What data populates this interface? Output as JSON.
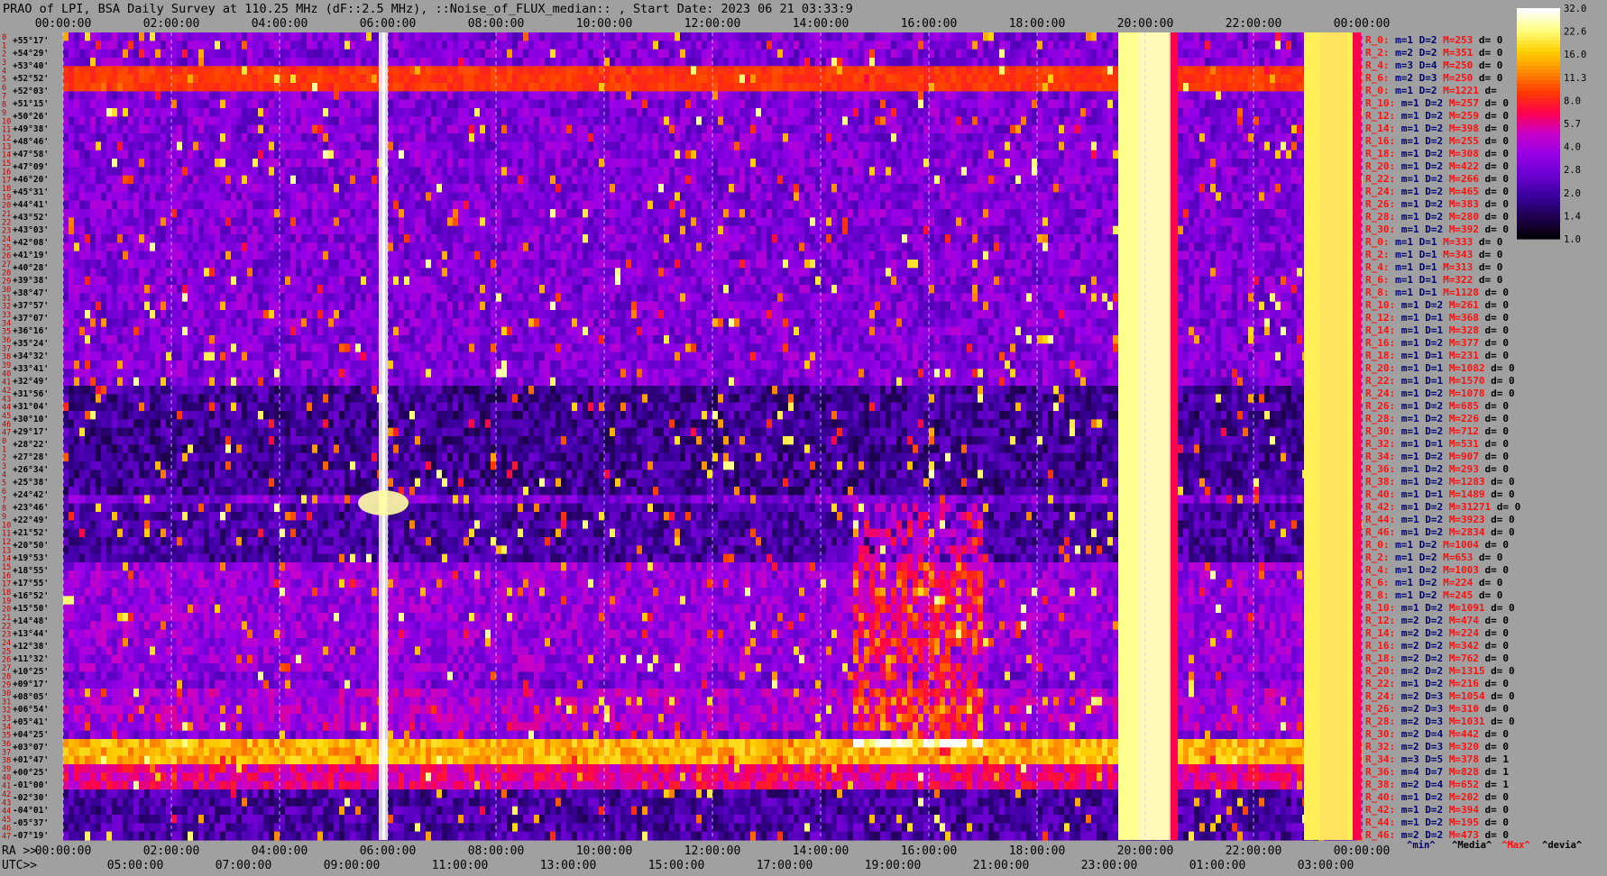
{
  "chart_data": {
    "type": "heatmap",
    "title": "PRAO of LPI, BSA Daily Survey at 110.25 MHz (dF::2.5 MHz), ::Noise_of_FLUX_median:: , Start Date: 2023 06 21 03:33:9",
    "top_time_ticks": [
      "00:00:00",
      "02:00:00",
      "04:00:00",
      "06:00:00",
      "08:00:00",
      "10:00:00",
      "12:00:00",
      "14:00:00",
      "16:00:00",
      "18:00:00",
      "20:00:00",
      "22:00:00",
      "00:00:00"
    ],
    "ra_prefix": "RA >>",
    "ra_ticks": [
      "00:00:00",
      "02:00:00",
      "04:00:00",
      "06:00:00",
      "08:00:00",
      "10:00:00",
      "12:00:00",
      "14:00:00",
      "16:00:00",
      "18:00:00",
      "20:00:00",
      "22:00:00",
      "00:00:00"
    ],
    "utc_prefix": "UTC>>",
    "utc_ticks": [
      "05:00:00",
      "07:00:00",
      "09:00:00",
      "11:00:00",
      "13:00:00",
      "15:00:00",
      "17:00:00",
      "19:00:00",
      "21:00:00",
      "23:00:00",
      "01:00:00",
      "03:00:00"
    ],
    "row_numbers": [
      "0",
      "1",
      "2",
      "3",
      "4",
      "5",
      "6",
      "7",
      "8",
      "9",
      "10",
      "11",
      "12",
      "13",
      "14",
      "15",
      "16",
      "17",
      "18",
      "19",
      "20",
      "21",
      "22",
      "23",
      "24",
      "25",
      "26",
      "27",
      "28",
      "29",
      "30",
      "31",
      "32",
      "33",
      "34",
      "35",
      "36",
      "37",
      "38",
      "39",
      "40",
      "41",
      "42",
      "43",
      "44",
      "45",
      "46",
      "47",
      "0",
      "1",
      "2",
      "3",
      "4",
      "5",
      "6",
      "7",
      "8",
      "9",
      "10",
      "11",
      "12",
      "13",
      "14",
      "15",
      "16",
      "17",
      "18",
      "19",
      "20",
      "21",
      "22",
      "23",
      "24",
      "25",
      "26",
      "27",
      "28",
      "29",
      "30",
      "31",
      "32",
      "33",
      "34",
      "35",
      "36",
      "37",
      "38",
      "39",
      "40",
      "41",
      "42",
      "43",
      "44",
      "45",
      "46",
      "47"
    ],
    "declinations": [
      "+55°17'",
      "+54°29'",
      "+53°40'",
      "+52°52'",
      "+52°03'",
      "+51°15'",
      "+50°26'",
      "+49°38'",
      "+48°46'",
      "+47°58'",
      "+47°09'",
      "+46°20'",
      "+45°31'",
      "+44°41'",
      "+43°52'",
      "+43°03'",
      "+42°08'",
      "+41°19'",
      "+40°28'",
      "+39°38'",
      "+38°47'",
      "+37°57'",
      "+37°07'",
      "+36°16'",
      "+35°24'",
      "+34°32'",
      "+33°41'",
      "+32°49'",
      "+31°56'",
      "+31°04'",
      "+30°10'",
      "+29°17'",
      "+28°22'",
      "+27°28'",
      "+26°34'",
      "+25°38'",
      "+24°42'",
      "+23°46'",
      "+22°49'",
      "+21°52'",
      "+20°50'",
      "+19°53'",
      "+18°55'",
      "+17°55'",
      "+16°52'",
      "+15°50'",
      "+14°48'",
      "+13°44'",
      "+12°38'",
      "+11°32'",
      "+10°25'",
      "+09°17'",
      "+08°05'",
      "+06°54'",
      "+05°41'",
      "+04°25'",
      "+03°07'",
      "+01°47'",
      "+00°25'",
      "-01°00'",
      "-02°30'",
      "-04°01'",
      "-05°37'",
      "-07°19'"
    ],
    "stats": [
      {
        "r": "R_0:",
        "m": "m=1",
        "d": "D=2",
        "M": "M=253",
        "dev": "d= 0"
      },
      {
        "r": "R_2:",
        "m": "m=2",
        "d": "D=2",
        "M": "M=351",
        "dev": "d= 0"
      },
      {
        "r": "R_4:",
        "m": "m=3",
        "d": "D=4",
        "M": "M=250",
        "dev": "d= 0"
      },
      {
        "r": "R_6:",
        "m": "m=2",
        "d": "D=3",
        "M": "M=250",
        "dev": "d= 0"
      },
      {
        "r": "R_0:",
        "m": "m=1",
        "d": "D=2",
        "M": "M=1221",
        "dev": "d="
      },
      {
        "r": "R_10:",
        "m": "m=1",
        "d": "D=2",
        "M": "M=257",
        "dev": "d= 0"
      },
      {
        "r": "R_12:",
        "m": "m=1",
        "d": "D=2",
        "M": "M=259",
        "dev": "d= 0"
      },
      {
        "r": "R_14:",
        "m": "m=1",
        "d": "D=2",
        "M": "M=398",
        "dev": "d= 0"
      },
      {
        "r": "R_16:",
        "m": "m=1",
        "d": "D=2",
        "M": "M=255",
        "dev": "d= 0"
      },
      {
        "r": "R_18:",
        "m": "m=1",
        "d": "D=2",
        "M": "M=308",
        "dev": "d= 0"
      },
      {
        "r": "R_20:",
        "m": "m=1",
        "d": "D=2",
        "M": "M=422",
        "dev": "d= 0"
      },
      {
        "r": "R_22:",
        "m": "m=1",
        "d": "D=2",
        "M": "M=266",
        "dev": "d= 0"
      },
      {
        "r": "R_24:",
        "m": "m=1",
        "d": "D=2",
        "M": "M=465",
        "dev": "d= 0"
      },
      {
        "r": "R_26:",
        "m": "m=1",
        "d": "D=2",
        "M": "M=383",
        "dev": "d= 0"
      },
      {
        "r": "R_28:",
        "m": "m=1",
        "d": "D=2",
        "M": "M=280",
        "dev": "d= 0"
      },
      {
        "r": "R_30:",
        "m": "m=1",
        "d": "D=2",
        "M": "M=392",
        "dev": "d= 0"
      },
      {
        "r": "R_0:",
        "m": "m=1",
        "d": "D=1",
        "M": "M=333",
        "dev": "d= 0"
      },
      {
        "r": "R_2:",
        "m": "m=1",
        "d": "D=1",
        "M": "M=343",
        "dev": "d= 0"
      },
      {
        "r": "R_4:",
        "m": "m=1",
        "d": "D=1",
        "M": "M=313",
        "dev": "d= 0"
      },
      {
        "r": "R_6:",
        "m": "m=1",
        "d": "D=1",
        "M": "M=322",
        "dev": "d= 0"
      },
      {
        "r": "R_8:",
        "m": "m=1",
        "d": "D=1",
        "M": "M=1128",
        "dev": "d= 0"
      },
      {
        "r": "R_10:",
        "m": "m=1",
        "d": "D=2",
        "M": "M=261",
        "dev": "d= 0"
      },
      {
        "r": "R_12:",
        "m": "m=1",
        "d": "D=1",
        "M": "M=368",
        "dev": "d= 0"
      },
      {
        "r": "R_14:",
        "m": "m=1",
        "d": "D=1",
        "M": "M=328",
        "dev": "d= 0"
      },
      {
        "r": "R_16:",
        "m": "m=1",
        "d": "D=2",
        "M": "M=377",
        "dev": "d= 0"
      },
      {
        "r": "R_18:",
        "m": "m=1",
        "d": "D=1",
        "M": "M=231",
        "dev": "d= 0"
      },
      {
        "r": "R_20:",
        "m": "m=1",
        "d": "D=1",
        "M": "M=1082",
        "dev": "d= 0"
      },
      {
        "r": "R_22:",
        "m": "m=1",
        "d": "D=1",
        "M": "M=1570",
        "dev": "d= 0"
      },
      {
        "r": "R_24:",
        "m": "m=1",
        "d": "D=2",
        "M": "M=1078",
        "dev": "d= 0"
      },
      {
        "r": "R_26:",
        "m": "m=1",
        "d": "D=2",
        "M": "M=685",
        "dev": "d= 0"
      },
      {
        "r": "R_28:",
        "m": "m=1",
        "d": "D=2",
        "M": "M=226",
        "dev": "d= 0"
      },
      {
        "r": "R_30:",
        "m": "m=1",
        "d": "D=2",
        "M": "M=712",
        "dev": "d= 0"
      },
      {
        "r": "R_32:",
        "m": "m=1",
        "d": "D=1",
        "M": "M=531",
        "dev": "d= 0"
      },
      {
        "r": "R_34:",
        "m": "m=1",
        "d": "D=2",
        "M": "M=907",
        "dev": "d= 0"
      },
      {
        "r": "R_36:",
        "m": "m=1",
        "d": "D=2",
        "M": "M=293",
        "dev": "d= 0"
      },
      {
        "r": "R_38:",
        "m": "m=1",
        "d": "D=2",
        "M": "M=1283",
        "dev": "d= 0"
      },
      {
        "r": "R_40:",
        "m": "m=1",
        "d": "D=1",
        "M": "M=1489",
        "dev": "d= 0"
      },
      {
        "r": "R_42:",
        "m": "m=1",
        "d": "D=2",
        "M": "M=31271",
        "dev": "d= 0"
      },
      {
        "r": "R_44:",
        "m": "m=1",
        "d": "D=2",
        "M": "M=3923",
        "dev": "d= 0"
      },
      {
        "r": "R_46:",
        "m": "m=1",
        "d": "D=2",
        "M": "M=2834",
        "dev": "d= 0"
      },
      {
        "r": "R_0:",
        "m": "m=1",
        "d": "D=2",
        "M": "M=1004",
        "dev": "d= 0"
      },
      {
        "r": "R_2:",
        "m": "m=1",
        "d": "D=2",
        "M": "M=653",
        "dev": "d= 0"
      },
      {
        "r": "R_4:",
        "m": "m=1",
        "d": "D=2",
        "M": "M=1003",
        "dev": "d= 0"
      },
      {
        "r": "R_6:",
        "m": "m=1",
        "d": "D=2",
        "M": "M=224",
        "dev": "d= 0"
      },
      {
        "r": "R_8:",
        "m": "m=1",
        "d": "D=2",
        "M": "M=245",
        "dev": "d= 0"
      },
      {
        "r": "R_10:",
        "m": "m=1",
        "d": "D=2",
        "M": "M=1091",
        "dev": "d= 0"
      },
      {
        "r": "R_12:",
        "m": "m=2",
        "d": "D=2",
        "M": "M=474",
        "dev": "d= 0"
      },
      {
        "r": "R_14:",
        "m": "m=2",
        "d": "D=2",
        "M": "M=224",
        "dev": "d= 0"
      },
      {
        "r": "R_16:",
        "m": "m=2",
        "d": "D=2",
        "M": "M=342",
        "dev": "d= 0"
      },
      {
        "r": "R_18:",
        "m": "m=2",
        "d": "D=2",
        "M": "M=762",
        "dev": "d= 0"
      },
      {
        "r": "R_20:",
        "m": "m=2",
        "d": "D=2",
        "M": "M=1315",
        "dev": "d= 0"
      },
      {
        "r": "R_22:",
        "m": "m=1",
        "d": "D=2",
        "M": "M=216",
        "dev": "d= 0"
      },
      {
        "r": "R_24:",
        "m": "m=2",
        "d": "D=3",
        "M": "M=1054",
        "dev": "d= 0"
      },
      {
        "r": "R_26:",
        "m": "m=2",
        "d": "D=3",
        "M": "M=310",
        "dev": "d= 0"
      },
      {
        "r": "R_28:",
        "m": "m=2",
        "d": "D=3",
        "M": "M=1031",
        "dev": "d= 0"
      },
      {
        "r": "R_30:",
        "m": "m=2",
        "d": "D=4",
        "M": "M=442",
        "dev": "d= 0"
      },
      {
        "r": "R_32:",
        "m": "m=2",
        "d": "D=3",
        "M": "M=320",
        "dev": "d= 0"
      },
      {
        "r": "R_34:",
        "m": "m=3",
        "d": "D=5",
        "M": "M=378",
        "dev": "d= 1"
      },
      {
        "r": "R_36:",
        "m": "m=4",
        "d": "D=7",
        "M": "M=828",
        "dev": "d= 1"
      },
      {
        "r": "R_38:",
        "m": "m=2",
        "d": "D=4",
        "M": "M=652",
        "dev": "d= 1"
      },
      {
        "r": "R_40:",
        "m": "m=1",
        "d": "D=2",
        "M": "M=202",
        "dev": "d= 0"
      },
      {
        "r": "R_42:",
        "m": "m=1",
        "d": "D=2",
        "M": "M=394",
        "dev": "d= 0"
      },
      {
        "r": "R_44:",
        "m": "m=1",
        "d": "D=2",
        "M": "M=195",
        "dev": "d= 0"
      },
      {
        "r": "R_46:",
        "m": "m=2",
        "d": "D=2",
        "M": "M=473",
        "dev": "d= 0"
      }
    ],
    "stats_legend": [
      "^min^",
      "^Media^",
      "^Max^",
      "^devia^"
    ],
    "colorbar_ticks": [
      "32.0",
      "22.6",
      "16.0",
      "11.3",
      "8.0",
      "5.7",
      "4.0",
      "2.8",
      "2.0",
      "1.4",
      "1.0"
    ],
    "colorscale": [
      "#04000a",
      "#1e0050",
      "#3c00a0",
      "#6a00d0",
      "#9600e8",
      "#c800c8",
      "#ff0050",
      "#ff3a00",
      "#ff8a00",
      "#ffd000",
      "#ffff80",
      "#ffffff"
    ],
    "colors": {
      "background": "#a0a0a0",
      "stat_label": "#ff1010",
      "stat_text": "#000070",
      "title_text": "#000000",
      "grid": "#d0d0ff"
    }
  }
}
